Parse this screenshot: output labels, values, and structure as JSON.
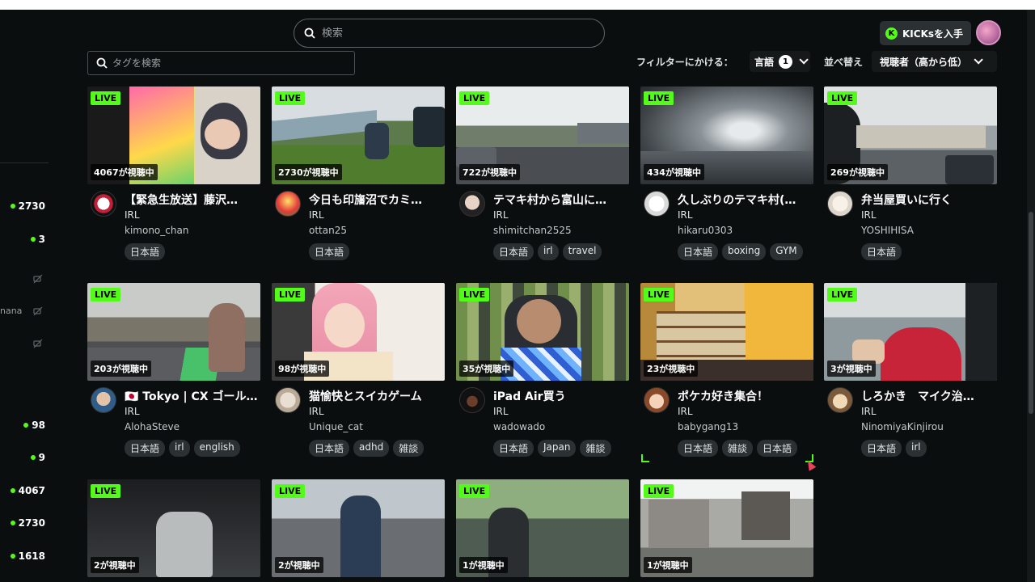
{
  "header": {
    "search_placeholder": "検索",
    "kicks_label": "KICKsを入手",
    "kicks_icon": "K"
  },
  "sidebar": {
    "items": [
      {
        "count": "2730"
      },
      {
        "count": "3"
      },
      {
        "count": "98"
      },
      {
        "count": "9"
      },
      {
        "count": "4067"
      },
      {
        "count": "2730"
      },
      {
        "count": "1618"
      }
    ],
    "partial_name": "nana"
  },
  "filters": {
    "tag_search_placeholder": "タグを検索",
    "filter_label": "フィルターにかける：",
    "language_label": "言語",
    "language_count": "1",
    "sort_label": "並べ替え",
    "sort_value": "視聴者（高から低）"
  },
  "live_label": "LIVE",
  "streams": [
    {
      "title": "【緊急生放送】藤沢…",
      "category": "IRL",
      "channel": "kimono_chan",
      "viewers": "4067が視聴中",
      "tags": [
        "日本語"
      ]
    },
    {
      "title": "今日も印旛沼でカミ…",
      "category": "IRL",
      "channel": "ottan25",
      "viewers": "2730が視聴中",
      "tags": [
        "日本語"
      ]
    },
    {
      "title": "テマキ村から富山に…",
      "category": "IRL",
      "channel": "shimitchan2525",
      "viewers": "722が視聴中",
      "tags": [
        "日本語",
        "irl",
        "travel"
      ]
    },
    {
      "title": "久しぶりのテマキ村(…",
      "category": "IRL",
      "channel": "hikaru0303",
      "viewers": "434が視聴中",
      "tags": [
        "日本語",
        "boxing",
        "GYM"
      ]
    },
    {
      "title": "弁当屋買いに行く",
      "category": "IRL",
      "channel": "YOSHIHISA",
      "viewers": "269が視聴中",
      "tags": [
        "日本語"
      ]
    },
    {
      "title": "🇯🇵 Tokyo | CX ゴール…",
      "category": "IRL",
      "channel": "AlohaSteve",
      "viewers": "203が視聴中",
      "tags": [
        "日本語",
        "irl",
        "english"
      ]
    },
    {
      "title": "猫愉快とスイカゲーム",
      "category": "IRL",
      "channel": "Unique_cat",
      "viewers": "98が視聴中",
      "tags": [
        "日本語",
        "adhd",
        "雑談"
      ]
    },
    {
      "title": "iPad Air買う",
      "category": "IRL",
      "channel": "wadowado",
      "viewers": "35が視聴中",
      "tags": [
        "日本語",
        "Japan",
        "雑談"
      ]
    },
    {
      "title": "ポケカ好き集合！",
      "category": "IRL",
      "channel": "babygang13",
      "viewers": "23が視聴中",
      "tags": [
        "日本語",
        "雑談",
        "日本語"
      ]
    },
    {
      "title": "しろかき　マイク治…",
      "category": "IRL",
      "channel": "NinomiyaKinjirou",
      "viewers": "3が視聴中",
      "tags": [
        "日本語",
        "irl"
      ]
    },
    {
      "viewers": "2が視聴中"
    },
    {
      "viewers": "2が視聴中"
    },
    {
      "viewers": "1が視聴中"
    },
    {
      "viewers": "1が視聴中"
    }
  ],
  "colors": {
    "accent": "#53fc18",
    "background": "#0b0e0f",
    "tag_bg": "#2b3133"
  }
}
